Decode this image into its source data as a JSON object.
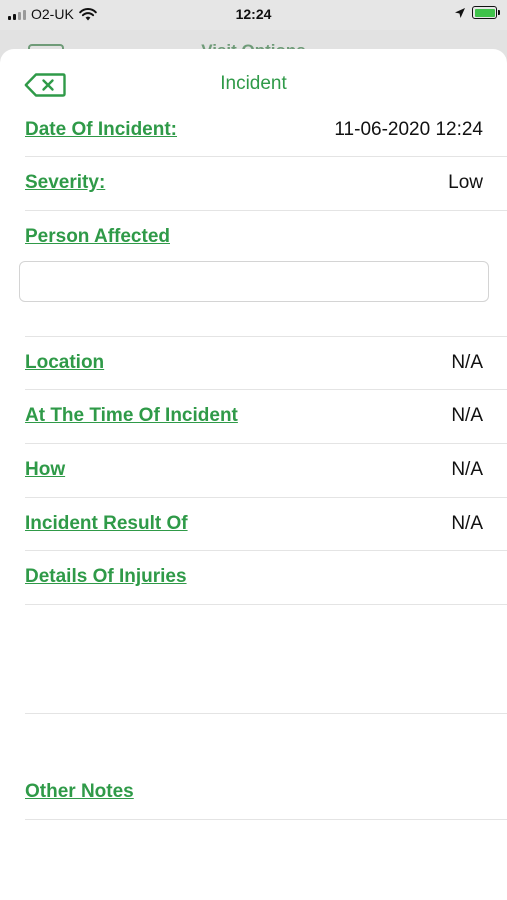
{
  "status_bar": {
    "carrier": "O2-UK",
    "time": "12:24"
  },
  "background_screen": {
    "title": "Visit Options"
  },
  "header": {
    "title": "Incident"
  },
  "fields": {
    "date_of_incident": {
      "label": "Date Of Incident:",
      "value": "11-06-2020 12:24"
    },
    "severity": {
      "label": "Severity:",
      "value": "Low"
    },
    "person_affected": {
      "label": "Person Affected",
      "value": ""
    },
    "location": {
      "label": "Location",
      "value": "N/A"
    },
    "at_the_time": {
      "label": "At The Time Of Incident",
      "value": "N/A"
    },
    "how": {
      "label": "How",
      "value": "N/A"
    },
    "incident_result_of": {
      "label": "Incident Result Of",
      "value": "N/A"
    },
    "details_of_injuries": {
      "label": "Details Of Injuries"
    },
    "other_notes": {
      "label": "Other Notes"
    }
  },
  "colors": {
    "accent": "#2f9a48",
    "battery": "#3fc24a"
  },
  "icons": {
    "back": "backspace-x-icon",
    "wifi": "wifi-icon",
    "location": "location-arrow-icon",
    "battery": "battery-charging-icon"
  }
}
